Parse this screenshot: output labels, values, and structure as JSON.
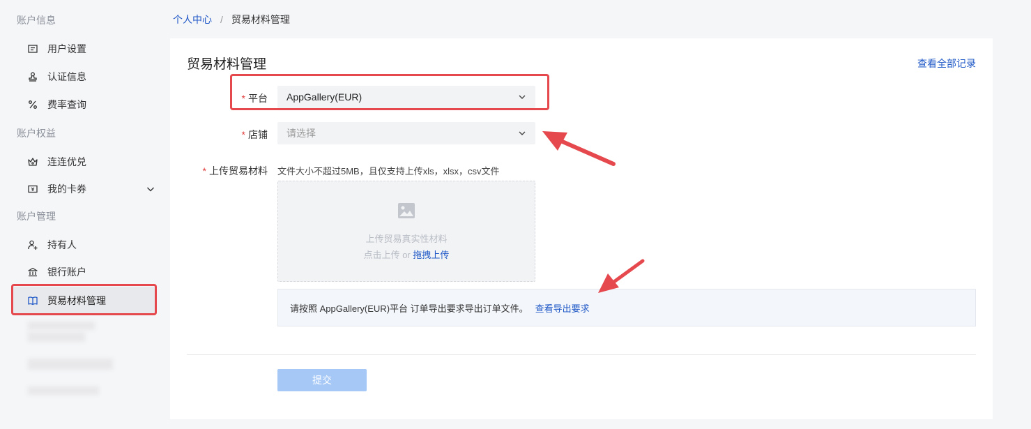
{
  "sidebar": {
    "groups": [
      {
        "title": "账户信息"
      },
      {
        "title": "账户权益"
      },
      {
        "title": "账户管理"
      }
    ],
    "items": [
      {
        "label": "用户设置",
        "icon": "id-card-icon"
      },
      {
        "label": "认证信息",
        "icon": "stamp-icon"
      },
      {
        "label": "费率查询",
        "icon": "percent-icon"
      },
      {
        "label": "连连优兑",
        "icon": "crown-icon"
      },
      {
        "label": "我的卡券",
        "icon": "ticket-icon"
      },
      {
        "label": "持有人",
        "icon": "user-add-icon"
      },
      {
        "label": "银行账户",
        "icon": "bank-icon"
      },
      {
        "label": "贸易材料管理",
        "icon": "book-icon"
      }
    ]
  },
  "breadcrumb": {
    "home": "个人中心",
    "separator": "/",
    "current": "贸易材料管理"
  },
  "main": {
    "title": "贸易材料管理",
    "view_all": "查看全部记录",
    "form": {
      "platform_label": "平台",
      "platform_value": "AppGallery(EUR)",
      "store_label": "店铺",
      "store_placeholder": "请选择",
      "upload_label": "上传贸易材料",
      "upload_hint": "文件大小不超过5MB，且仅支持上传xls，xlsx，csv文件",
      "upload_title": "上传贸易真实性材料",
      "upload_click": "点击上传",
      "upload_or": " or ",
      "upload_drag": "拖拽上传",
      "required_mark": "*"
    },
    "notice": {
      "text": "请按照 AppGallery(EUR)平台 订单导出要求导出订单文件。",
      "link": "查看导出要求"
    },
    "submit_label": "提交"
  },
  "colors": {
    "accent": "#1f58c7",
    "highlight": "#e6494d",
    "submit_disabled": "#a5c8f7",
    "required": "#e03b3b"
  }
}
